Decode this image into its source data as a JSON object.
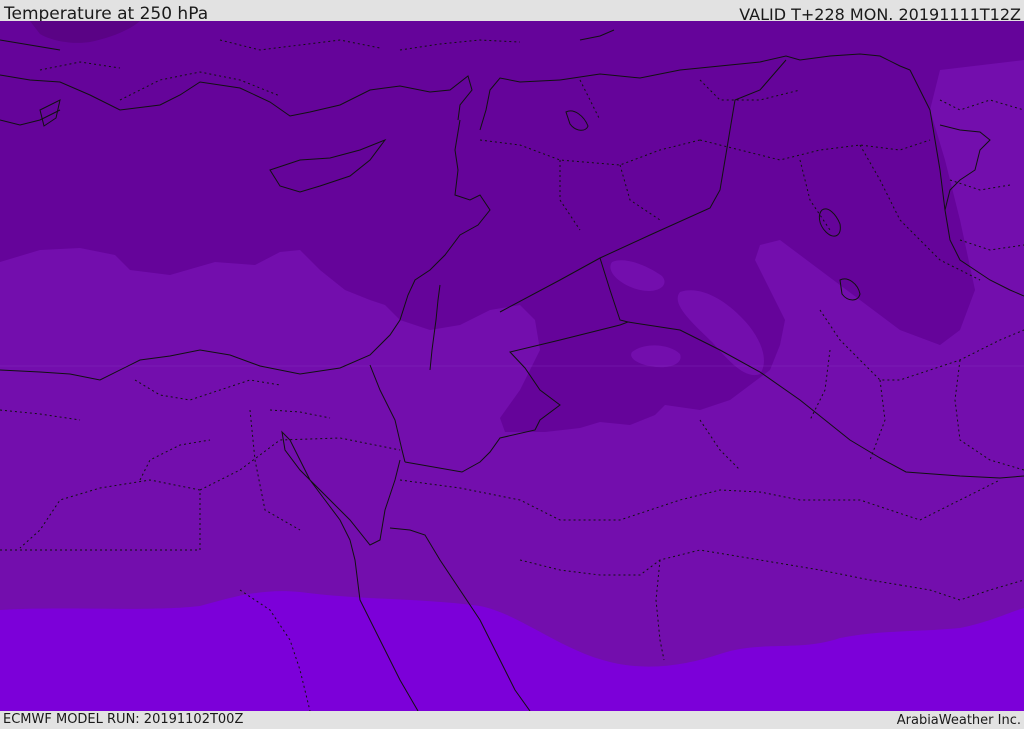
{
  "header": {
    "title": "Temperature at 250 hPa",
    "valid": "VALID T+228 MON. 20191111T12Z"
  },
  "footer": {
    "model_run": "ECMWF MODEL RUN: 20191102T00Z",
    "credit": "ArabiaWeather Inc."
  },
  "map": {
    "variable": "temperature",
    "level": "250 hPa",
    "colors": {
      "band_coldest": "#5a0385",
      "band_cold": "#65049a",
      "band_mid": "#730ead",
      "band_warm": "#7c00d9",
      "border": "#111111"
    }
  }
}
